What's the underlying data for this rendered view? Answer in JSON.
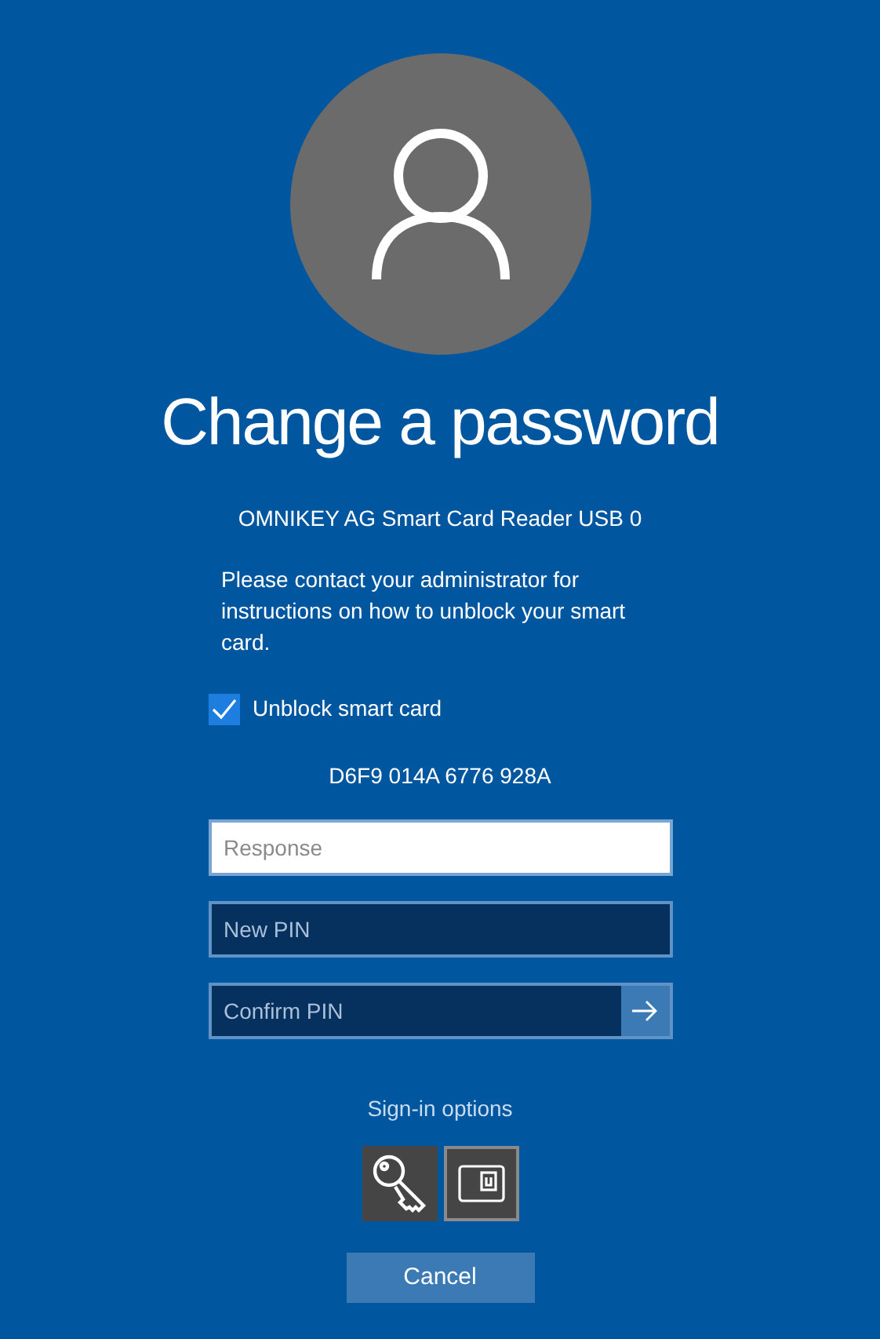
{
  "title": "Change a password",
  "reader": "OMNIKEY AG Smart Card Reader USB 0",
  "message": "Please contact your administrator for instructions on how to unblock your smart card.",
  "unblock": {
    "label": "Unblock smart card",
    "checked": true
  },
  "challenge": "D6F9 014A 6776 928A",
  "fields": [
    {
      "placeholder": "Response",
      "focused": true,
      "submit": false
    },
    {
      "placeholder": "New PIN",
      "focused": false,
      "submit": false
    },
    {
      "placeholder": "Confirm PIN",
      "focused": false,
      "submit": true
    }
  ],
  "sign_in_options": {
    "label": "Sign-in options",
    "options": [
      {
        "kind": "key",
        "selected": false
      },
      {
        "kind": "card",
        "selected": true
      }
    ]
  },
  "cancel": "Cancel"
}
